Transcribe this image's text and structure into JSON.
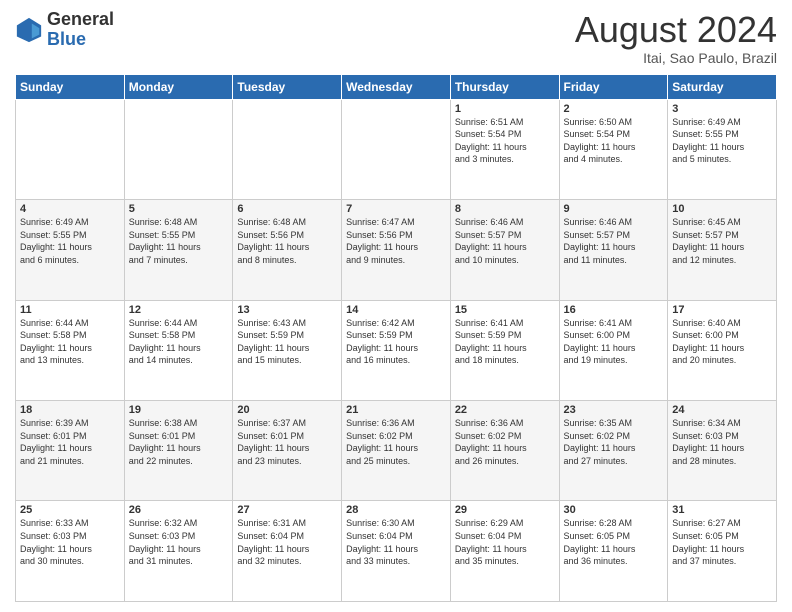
{
  "header": {
    "logo_general": "General",
    "logo_blue": "Blue",
    "month_year": "August 2024",
    "location": "Itai, Sao Paulo, Brazil"
  },
  "weekdays": [
    "Sunday",
    "Monday",
    "Tuesday",
    "Wednesday",
    "Thursday",
    "Friday",
    "Saturday"
  ],
  "weeks": [
    [
      {
        "day": "",
        "detail": ""
      },
      {
        "day": "",
        "detail": ""
      },
      {
        "day": "",
        "detail": ""
      },
      {
        "day": "",
        "detail": ""
      },
      {
        "day": "1",
        "detail": "Sunrise: 6:51 AM\nSunset: 5:54 PM\nDaylight: 11 hours\nand 3 minutes."
      },
      {
        "day": "2",
        "detail": "Sunrise: 6:50 AM\nSunset: 5:54 PM\nDaylight: 11 hours\nand 4 minutes."
      },
      {
        "day": "3",
        "detail": "Sunrise: 6:49 AM\nSunset: 5:55 PM\nDaylight: 11 hours\nand 5 minutes."
      }
    ],
    [
      {
        "day": "4",
        "detail": "Sunrise: 6:49 AM\nSunset: 5:55 PM\nDaylight: 11 hours\nand 6 minutes."
      },
      {
        "day": "5",
        "detail": "Sunrise: 6:48 AM\nSunset: 5:55 PM\nDaylight: 11 hours\nand 7 minutes."
      },
      {
        "day": "6",
        "detail": "Sunrise: 6:48 AM\nSunset: 5:56 PM\nDaylight: 11 hours\nand 8 minutes."
      },
      {
        "day": "7",
        "detail": "Sunrise: 6:47 AM\nSunset: 5:56 PM\nDaylight: 11 hours\nand 9 minutes."
      },
      {
        "day": "8",
        "detail": "Sunrise: 6:46 AM\nSunset: 5:57 PM\nDaylight: 11 hours\nand 10 minutes."
      },
      {
        "day": "9",
        "detail": "Sunrise: 6:46 AM\nSunset: 5:57 PM\nDaylight: 11 hours\nand 11 minutes."
      },
      {
        "day": "10",
        "detail": "Sunrise: 6:45 AM\nSunset: 5:57 PM\nDaylight: 11 hours\nand 12 minutes."
      }
    ],
    [
      {
        "day": "11",
        "detail": "Sunrise: 6:44 AM\nSunset: 5:58 PM\nDaylight: 11 hours\nand 13 minutes."
      },
      {
        "day": "12",
        "detail": "Sunrise: 6:44 AM\nSunset: 5:58 PM\nDaylight: 11 hours\nand 14 minutes."
      },
      {
        "day": "13",
        "detail": "Sunrise: 6:43 AM\nSunset: 5:59 PM\nDaylight: 11 hours\nand 15 minutes."
      },
      {
        "day": "14",
        "detail": "Sunrise: 6:42 AM\nSunset: 5:59 PM\nDaylight: 11 hours\nand 16 minutes."
      },
      {
        "day": "15",
        "detail": "Sunrise: 6:41 AM\nSunset: 5:59 PM\nDaylight: 11 hours\nand 18 minutes."
      },
      {
        "day": "16",
        "detail": "Sunrise: 6:41 AM\nSunset: 6:00 PM\nDaylight: 11 hours\nand 19 minutes."
      },
      {
        "day": "17",
        "detail": "Sunrise: 6:40 AM\nSunset: 6:00 PM\nDaylight: 11 hours\nand 20 minutes."
      }
    ],
    [
      {
        "day": "18",
        "detail": "Sunrise: 6:39 AM\nSunset: 6:01 PM\nDaylight: 11 hours\nand 21 minutes."
      },
      {
        "day": "19",
        "detail": "Sunrise: 6:38 AM\nSunset: 6:01 PM\nDaylight: 11 hours\nand 22 minutes."
      },
      {
        "day": "20",
        "detail": "Sunrise: 6:37 AM\nSunset: 6:01 PM\nDaylight: 11 hours\nand 23 minutes."
      },
      {
        "day": "21",
        "detail": "Sunrise: 6:36 AM\nSunset: 6:02 PM\nDaylight: 11 hours\nand 25 minutes."
      },
      {
        "day": "22",
        "detail": "Sunrise: 6:36 AM\nSunset: 6:02 PM\nDaylight: 11 hours\nand 26 minutes."
      },
      {
        "day": "23",
        "detail": "Sunrise: 6:35 AM\nSunset: 6:02 PM\nDaylight: 11 hours\nand 27 minutes."
      },
      {
        "day": "24",
        "detail": "Sunrise: 6:34 AM\nSunset: 6:03 PM\nDaylight: 11 hours\nand 28 minutes."
      }
    ],
    [
      {
        "day": "25",
        "detail": "Sunrise: 6:33 AM\nSunset: 6:03 PM\nDaylight: 11 hours\nand 30 minutes."
      },
      {
        "day": "26",
        "detail": "Sunrise: 6:32 AM\nSunset: 6:03 PM\nDaylight: 11 hours\nand 31 minutes."
      },
      {
        "day": "27",
        "detail": "Sunrise: 6:31 AM\nSunset: 6:04 PM\nDaylight: 11 hours\nand 32 minutes."
      },
      {
        "day": "28",
        "detail": "Sunrise: 6:30 AM\nSunset: 6:04 PM\nDaylight: 11 hours\nand 33 minutes."
      },
      {
        "day": "29",
        "detail": "Sunrise: 6:29 AM\nSunset: 6:04 PM\nDaylight: 11 hours\nand 35 minutes."
      },
      {
        "day": "30",
        "detail": "Sunrise: 6:28 AM\nSunset: 6:05 PM\nDaylight: 11 hours\nand 36 minutes."
      },
      {
        "day": "31",
        "detail": "Sunrise: 6:27 AM\nSunset: 6:05 PM\nDaylight: 11 hours\nand 37 minutes."
      }
    ]
  ]
}
